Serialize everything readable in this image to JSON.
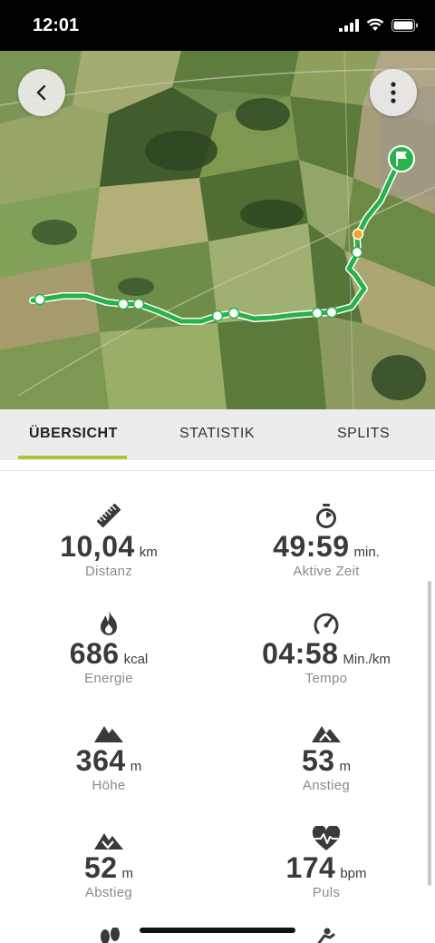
{
  "status_bar": {
    "time": "12:01"
  },
  "tabs": [
    {
      "label": "ÜBERSICHT",
      "active": true
    },
    {
      "label": "STATISTIK",
      "active": false
    },
    {
      "label": "SPLITS",
      "active": false
    }
  ],
  "stats": {
    "distance": {
      "value": "10,04",
      "unit": "km",
      "label": "Distanz",
      "icon": "ruler-icon"
    },
    "active_time": {
      "value": "49:59",
      "unit": "min.",
      "label": "Aktive Zeit",
      "icon": "stopwatch-icon"
    },
    "energy": {
      "value": "686",
      "unit": "kcal",
      "label": "Energie",
      "icon": "flame-icon"
    },
    "pace": {
      "value": "04:58",
      "unit": "Min./km",
      "label": "Tempo",
      "icon": "speedometer-icon"
    },
    "altitude": {
      "value": "364",
      "unit": "m",
      "label": "Höhe",
      "icon": "mountain-icon"
    },
    "ascent": {
      "value": "53",
      "unit": "m",
      "label": "Anstieg",
      "icon": "ascent-icon"
    },
    "descent": {
      "value": "52",
      "unit": "m",
      "label": "Abstieg",
      "icon": "descent-icon"
    },
    "heart_rate": {
      "value": "174",
      "unit": "bpm",
      "label": "Puls",
      "icon": "heart-pulse-icon"
    }
  },
  "colors": {
    "route": "#27b24a",
    "accent": "#a8c63a",
    "finish_marker": "#27b24a",
    "current_marker": "#f5a623"
  }
}
